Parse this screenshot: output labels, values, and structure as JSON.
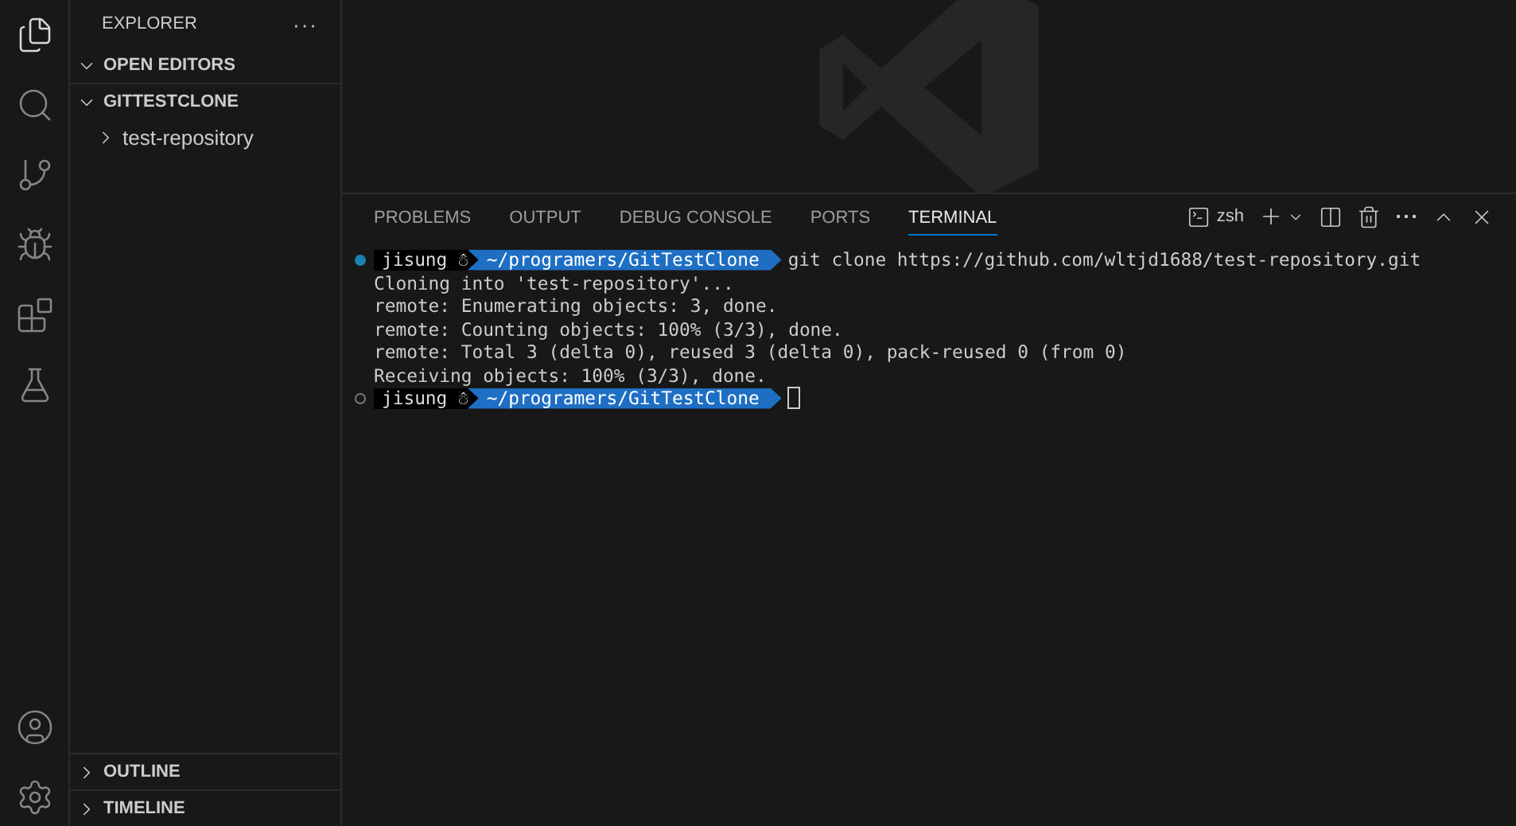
{
  "activity_bar": {
    "top": [
      {
        "kind": "files",
        "selected": true
      },
      {
        "kind": "search",
        "selected": false
      },
      {
        "kind": "source-control",
        "selected": false
      },
      {
        "kind": "run",
        "selected": false
      },
      {
        "kind": "extensions",
        "selected": false
      },
      {
        "kind": "testing",
        "selected": false
      }
    ],
    "bottom": [
      {
        "kind": "account",
        "selected": false
      },
      {
        "kind": "settings",
        "selected": false
      }
    ]
  },
  "sidebar": {
    "title": "EXPLORER",
    "more": "···",
    "sections": [
      {
        "label": "OPEN EDITORS",
        "expanded": true
      },
      {
        "label": "GITTESTCLONE",
        "expanded": true,
        "items": [
          {
            "label": "test-repository",
            "expanded": false
          }
        ]
      }
    ],
    "bottom_sections": [
      {
        "label": "OUTLINE",
        "expanded": false
      },
      {
        "label": "TIMELINE",
        "expanded": false
      }
    ]
  },
  "panel": {
    "tabs": [
      {
        "label": "PROBLEMS",
        "selected": false
      },
      {
        "label": "OUTPUT",
        "selected": false
      },
      {
        "label": "DEBUG CONSOLE",
        "selected": false
      },
      {
        "label": "PORTS",
        "selected": false
      },
      {
        "label": "TERMINAL",
        "selected": true
      }
    ],
    "shell": "zsh",
    "lines": [
      {
        "kind": "prompt",
        "finished": true,
        "user": "jisung ☃",
        "path": "~/programers/GitTestClone",
        "command": "git clone https://github.com/wltjd1688/test-repository.git",
        "cursor": false
      },
      {
        "kind": "output",
        "text": "Cloning into 'test-repository'..."
      },
      {
        "kind": "output",
        "text": "remote: Enumerating objects: 3, done."
      },
      {
        "kind": "output",
        "text": "remote: Counting objects: 100% (3/3), done."
      },
      {
        "kind": "output",
        "text": "remote: Total 3 (delta 0), reused 3 (delta 0), pack-reused 0 (from 0)"
      },
      {
        "kind": "output",
        "text": "Receiving objects: 100% (3/3), done."
      },
      {
        "kind": "prompt",
        "finished": false,
        "user": "jisung ☃",
        "path": "~/programers/GitTestClone",
        "cursor": true
      }
    ]
  }
}
